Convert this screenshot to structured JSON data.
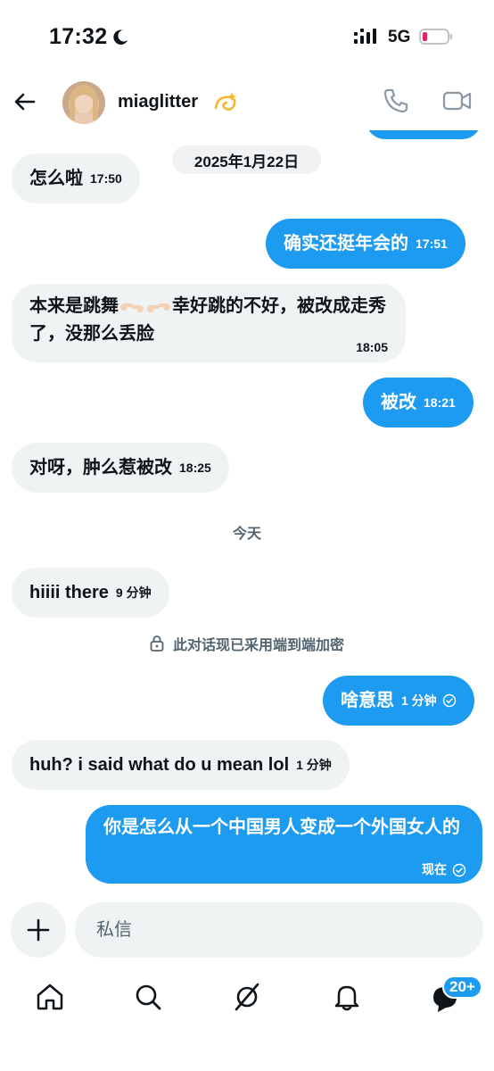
{
  "status_bar": {
    "time": "17:32",
    "network": "5G",
    "icons": [
      "moon-icon",
      "signal-icon",
      "battery-low-icon"
    ],
    "battery_color": "#e0245e"
  },
  "header": {
    "username": "miaglitter",
    "username_emoji": "dizzy-icon",
    "icons": [
      "back-arrow-icon",
      "phone-icon",
      "video-icon"
    ]
  },
  "conversation": {
    "date_separator": "2025年1月22日",
    "today_label": "今天",
    "encryption_notice": "此对话现已采用端到端加密",
    "messages": [
      {
        "side": "in",
        "text": "怎么啦",
        "time": "17:50"
      },
      {
        "side": "out",
        "text": "确实还挺年会的",
        "time": "17:51"
      },
      {
        "side": "in",
        "text_before": "本来是跳舞",
        "emoji": "backhand-pointing-right-left",
        "text_after": "幸好跳的不好，被改成走秀了，没那么丢脸",
        "time": "18:05"
      },
      {
        "side": "out",
        "text": "被改",
        "time": "18:21"
      },
      {
        "side": "in",
        "text": "对呀，肿么惹被改",
        "time": "18:25"
      },
      {
        "side": "in",
        "text": "hiiii there",
        "time": "9 分钟"
      },
      {
        "side": "out",
        "text": "啥意思",
        "time": "1 分钟",
        "read": true
      },
      {
        "side": "in",
        "text": "huh? i said what do u mean lol",
        "time": "1 分钟"
      },
      {
        "side": "out",
        "text": "你是怎么从一个中国男人变成一个外国女人的",
        "time": "现在",
        "read": true
      }
    ]
  },
  "composer": {
    "placeholder": "私信",
    "add_icon": "plus-icon"
  },
  "bottom_nav": {
    "items": [
      "home-icon",
      "search-icon",
      "grok-icon",
      "notifications-icon",
      "messages-icon"
    ],
    "messages_badge": "20+"
  },
  "colors": {
    "accent": "#1d9bf0",
    "incoming_bubble": "#eff3f4",
    "secondary_text": "#536471"
  }
}
